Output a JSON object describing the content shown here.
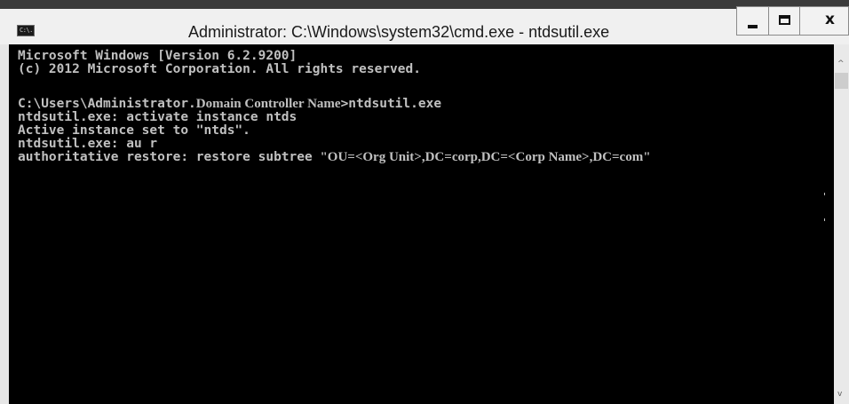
{
  "window": {
    "title": "Administrator: C:\\Windows\\system32\\cmd.exe - ntdsutil.exe",
    "icon_label": "C:\\.",
    "icon": "cmd-console-icon",
    "minimize_icon": "minimize-icon",
    "maximize_icon": "maximize-icon",
    "close_icon": "close-icon",
    "close_label": "x"
  },
  "console": {
    "lines": [
      "Microsoft Windows [Version 6.2.9200]",
      "(c) 2012 Microsoft Corporation. All rights reserved.",
      "",
      "C:\\Users\\Administrator.",
      "ntdsutil.exe: activate instance ntds",
      "Active instance set to \"ntds\".",
      "ntdsutil.exe: au r",
      "authoritative restore: restore subtree "
    ],
    "line4_serif": "Domain Controller Name",
    "line4_tail": ">ntdsutil.exe",
    "line8_serif": "\"OU=<Org Unit>,DC=corp,DC=<Corp Name>,DC=com\""
  },
  "colors": {
    "console_background": "#000000",
    "console_text": "#c0c0c0",
    "titlebar_background": "#f0f0f0"
  }
}
